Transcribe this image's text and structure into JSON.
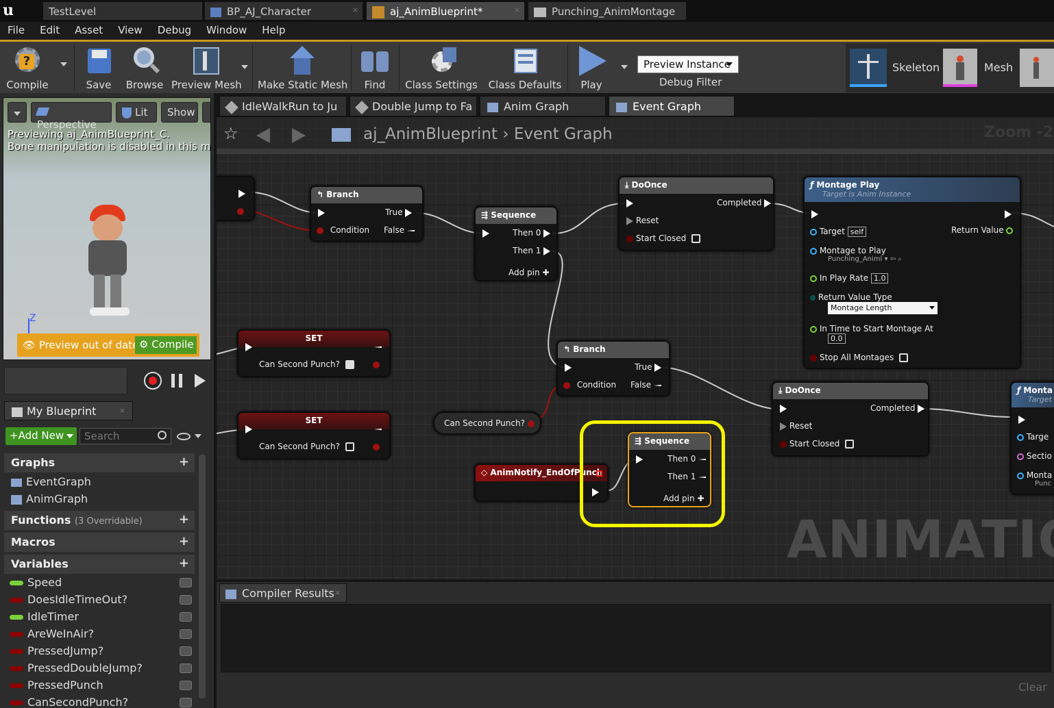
{
  "tabs": [
    {
      "label": "TestLevel"
    },
    {
      "label": "BP_AJ_Character"
    },
    {
      "label": "aj_AnimBlueprint*"
    },
    {
      "label": "Punching_AnimMontage"
    }
  ],
  "menu": [
    "File",
    "Edit",
    "Asset",
    "View",
    "Debug",
    "Window",
    "Help"
  ],
  "toolbar": {
    "compile": "Compile",
    "save": "Save",
    "browse": "Browse",
    "preview_mesh": "Preview Mesh",
    "make_static_mesh": "Make Static Mesh",
    "find": "Find",
    "class_settings": "Class Settings",
    "class_defaults": "Class Defaults",
    "play": "Play",
    "preview_instance": "Preview Instance",
    "debug_filter": "Debug Filter",
    "skeleton": "Skeleton",
    "mesh": "Mesh"
  },
  "viewport": {
    "perspective": "Perspective",
    "lit": "Lit",
    "show": "Show",
    "line1": "Previewing aj_AnimBlueprint_C.",
    "line2": "Bone manipulation is disabled in this mode",
    "axis": "Z",
    "preview_out": "Preview out of date",
    "compile": "Compile"
  },
  "graph_tabs": [
    {
      "label": "IdleWalkRun to Ju"
    },
    {
      "label": "Double Jump to Fa"
    },
    {
      "label": "Anim Graph"
    },
    {
      "label": "Event Graph"
    }
  ],
  "breadcrumb": {
    "bp": "aj_AnimBlueprint",
    "sep": "›",
    "graph": "Event Graph",
    "zoom": "Zoom -2"
  },
  "myblueprint": {
    "title": "My Blueprint",
    "add_new": "Add New",
    "search_placeholder": "Search",
    "graphs": "Graphs",
    "eventgraph": "EventGraph",
    "animgraph": "AnimGraph",
    "functions": "Functions",
    "overridable": "(3 Overridable)",
    "macros": "Macros",
    "variables": "Variables",
    "vars": [
      {
        "name": "Speed",
        "color": "#7ad23a"
      },
      {
        "name": "DoesIdleTimeOut?",
        "color": "#8b0000"
      },
      {
        "name": "IdleTimer",
        "color": "#7ad23a"
      },
      {
        "name": "AreWeInAir?",
        "color": "#8b0000"
      },
      {
        "name": "PressedJump?",
        "color": "#8b0000"
      },
      {
        "name": "PressedDoubleJump?",
        "color": "#8b0000"
      },
      {
        "name": "PressedPunch",
        "color": "#8b0000"
      },
      {
        "name": "CanSecondPunch?",
        "color": "#8b0000"
      }
    ]
  },
  "nodes": {
    "branch1": {
      "title": "Branch",
      "true": "True",
      "false": "False",
      "condition": "Condition"
    },
    "seq1": {
      "title": "Sequence",
      "then0": "Then 0",
      "then1": "Then 1",
      "addpin": "Add pin"
    },
    "doonce1": {
      "title": "DoOnce",
      "completed": "Completed",
      "reset": "Reset",
      "start_closed": "Start Closed"
    },
    "montage": {
      "title": "Montage Play",
      "subtitle": "Target is Anim Instance",
      "target": "Target",
      "self": "self",
      "return_value": "Return Value",
      "montage_to_play": "Montage to Play",
      "montage_val": "Punching_Animl",
      "play_rate": "In Play Rate",
      "play_rate_val": "1.0",
      "return_type": "Return Value Type",
      "return_type_val": "Montage Length",
      "time_start": "In Time to Start Montage At",
      "time_val": "0.0",
      "stop_all": "Stop All Montages"
    },
    "set1": {
      "title": "SET",
      "var": "Can Second Punch?"
    },
    "set2": {
      "title": "SET",
      "var": "Can Second Punch?"
    },
    "branch2": {
      "title": "Branch",
      "true": "True",
      "false": "False",
      "condition": "Condition"
    },
    "getvar": {
      "label": "Can Second Punch?"
    },
    "doonce2": {
      "title": "DoOnce",
      "completed": "Completed",
      "reset": "Reset",
      "start_closed": "Start Closed"
    },
    "notify": {
      "title": "AnimNotify_EndOfPunch"
    },
    "seq2": {
      "title": "Sequence",
      "then0": "Then 0",
      "then1": "Then 1",
      "addpin": "Add pin"
    },
    "montage2": {
      "title": "Monta",
      "subtitle": "Target",
      "target": "Targe",
      "section": "Sectio",
      "montage": "Monta",
      "punch": "Punc"
    }
  },
  "watermark": "ANIMATION",
  "compiler": {
    "tab": "Compiler Results",
    "clear": "Clear"
  }
}
